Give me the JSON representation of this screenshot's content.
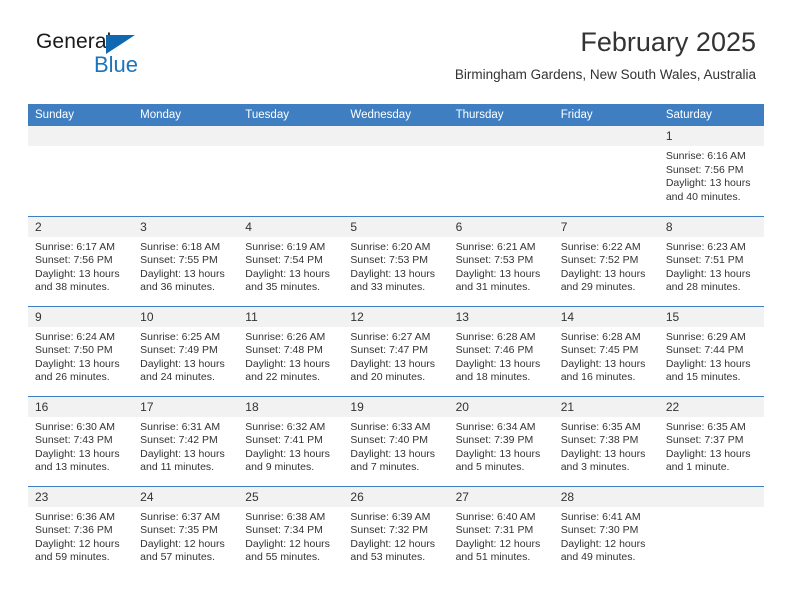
{
  "brand": {
    "name_top": "General",
    "name_bottom": "Blue",
    "accent_color": "#1b75bb",
    "triangle_color": "#1068b0"
  },
  "header": {
    "month_title": "February 2025",
    "location": "Birmingham Gardens, New South Wales, Australia"
  },
  "theme": {
    "header_row_bg": "#3f7fc1",
    "header_row_text": "#ffffff",
    "daynum_bg": "#f2f2f2",
    "body_text": "#333333",
    "week_divider": "#3f7fc1"
  },
  "weekday_headers": [
    "Sunday",
    "Monday",
    "Tuesday",
    "Wednesday",
    "Thursday",
    "Friday",
    "Saturday"
  ],
  "labels": {
    "sunrise_prefix": "Sunrise:",
    "sunset_prefix": "Sunset:",
    "daylight_prefix": "Daylight:"
  },
  "weeks": [
    [
      {
        "blank": true
      },
      {
        "blank": true
      },
      {
        "blank": true
      },
      {
        "blank": true
      },
      {
        "blank": true
      },
      {
        "blank": true
      },
      {
        "day": "1",
        "sunrise": "Sunrise: 6:16 AM",
        "sunset": "Sunset: 7:56 PM",
        "daylight": "Daylight: 13 hours and 40 minutes."
      }
    ],
    [
      {
        "day": "2",
        "sunrise": "Sunrise: 6:17 AM",
        "sunset": "Sunset: 7:56 PM",
        "daylight": "Daylight: 13 hours and 38 minutes."
      },
      {
        "day": "3",
        "sunrise": "Sunrise: 6:18 AM",
        "sunset": "Sunset: 7:55 PM",
        "daylight": "Daylight: 13 hours and 36 minutes."
      },
      {
        "day": "4",
        "sunrise": "Sunrise: 6:19 AM",
        "sunset": "Sunset: 7:54 PM",
        "daylight": "Daylight: 13 hours and 35 minutes."
      },
      {
        "day": "5",
        "sunrise": "Sunrise: 6:20 AM",
        "sunset": "Sunset: 7:53 PM",
        "daylight": "Daylight: 13 hours and 33 minutes."
      },
      {
        "day": "6",
        "sunrise": "Sunrise: 6:21 AM",
        "sunset": "Sunset: 7:53 PM",
        "daylight": "Daylight: 13 hours and 31 minutes."
      },
      {
        "day": "7",
        "sunrise": "Sunrise: 6:22 AM",
        "sunset": "Sunset: 7:52 PM",
        "daylight": "Daylight: 13 hours and 29 minutes."
      },
      {
        "day": "8",
        "sunrise": "Sunrise: 6:23 AM",
        "sunset": "Sunset: 7:51 PM",
        "daylight": "Daylight: 13 hours and 28 minutes."
      }
    ],
    [
      {
        "day": "9",
        "sunrise": "Sunrise: 6:24 AM",
        "sunset": "Sunset: 7:50 PM",
        "daylight": "Daylight: 13 hours and 26 minutes."
      },
      {
        "day": "10",
        "sunrise": "Sunrise: 6:25 AM",
        "sunset": "Sunset: 7:49 PM",
        "daylight": "Daylight: 13 hours and 24 minutes."
      },
      {
        "day": "11",
        "sunrise": "Sunrise: 6:26 AM",
        "sunset": "Sunset: 7:48 PM",
        "daylight": "Daylight: 13 hours and 22 minutes."
      },
      {
        "day": "12",
        "sunrise": "Sunrise: 6:27 AM",
        "sunset": "Sunset: 7:47 PM",
        "daylight": "Daylight: 13 hours and 20 minutes."
      },
      {
        "day": "13",
        "sunrise": "Sunrise: 6:28 AM",
        "sunset": "Sunset: 7:46 PM",
        "daylight": "Daylight: 13 hours and 18 minutes."
      },
      {
        "day": "14",
        "sunrise": "Sunrise: 6:28 AM",
        "sunset": "Sunset: 7:45 PM",
        "daylight": "Daylight: 13 hours and 16 minutes."
      },
      {
        "day": "15",
        "sunrise": "Sunrise: 6:29 AM",
        "sunset": "Sunset: 7:44 PM",
        "daylight": "Daylight: 13 hours and 15 minutes."
      }
    ],
    [
      {
        "day": "16",
        "sunrise": "Sunrise: 6:30 AM",
        "sunset": "Sunset: 7:43 PM",
        "daylight": "Daylight: 13 hours and 13 minutes."
      },
      {
        "day": "17",
        "sunrise": "Sunrise: 6:31 AM",
        "sunset": "Sunset: 7:42 PM",
        "daylight": "Daylight: 13 hours and 11 minutes."
      },
      {
        "day": "18",
        "sunrise": "Sunrise: 6:32 AM",
        "sunset": "Sunset: 7:41 PM",
        "daylight": "Daylight: 13 hours and 9 minutes."
      },
      {
        "day": "19",
        "sunrise": "Sunrise: 6:33 AM",
        "sunset": "Sunset: 7:40 PM",
        "daylight": "Daylight: 13 hours and 7 minutes."
      },
      {
        "day": "20",
        "sunrise": "Sunrise: 6:34 AM",
        "sunset": "Sunset: 7:39 PM",
        "daylight": "Daylight: 13 hours and 5 minutes."
      },
      {
        "day": "21",
        "sunrise": "Sunrise: 6:35 AM",
        "sunset": "Sunset: 7:38 PM",
        "daylight": "Daylight: 13 hours and 3 minutes."
      },
      {
        "day": "22",
        "sunrise": "Sunrise: 6:35 AM",
        "sunset": "Sunset: 7:37 PM",
        "daylight": "Daylight: 13 hours and 1 minute."
      }
    ],
    [
      {
        "day": "23",
        "sunrise": "Sunrise: 6:36 AM",
        "sunset": "Sunset: 7:36 PM",
        "daylight": "Daylight: 12 hours and 59 minutes."
      },
      {
        "day": "24",
        "sunrise": "Sunrise: 6:37 AM",
        "sunset": "Sunset: 7:35 PM",
        "daylight": "Daylight: 12 hours and 57 minutes."
      },
      {
        "day": "25",
        "sunrise": "Sunrise: 6:38 AM",
        "sunset": "Sunset: 7:34 PM",
        "daylight": "Daylight: 12 hours and 55 minutes."
      },
      {
        "day": "26",
        "sunrise": "Sunrise: 6:39 AM",
        "sunset": "Sunset: 7:32 PM",
        "daylight": "Daylight: 12 hours and 53 minutes."
      },
      {
        "day": "27",
        "sunrise": "Sunrise: 6:40 AM",
        "sunset": "Sunset: 7:31 PM",
        "daylight": "Daylight: 12 hours and 51 minutes."
      },
      {
        "day": "28",
        "sunrise": "Sunrise: 6:41 AM",
        "sunset": "Sunset: 7:30 PM",
        "daylight": "Daylight: 12 hours and 49 minutes."
      },
      {
        "blank": true
      }
    ]
  ]
}
